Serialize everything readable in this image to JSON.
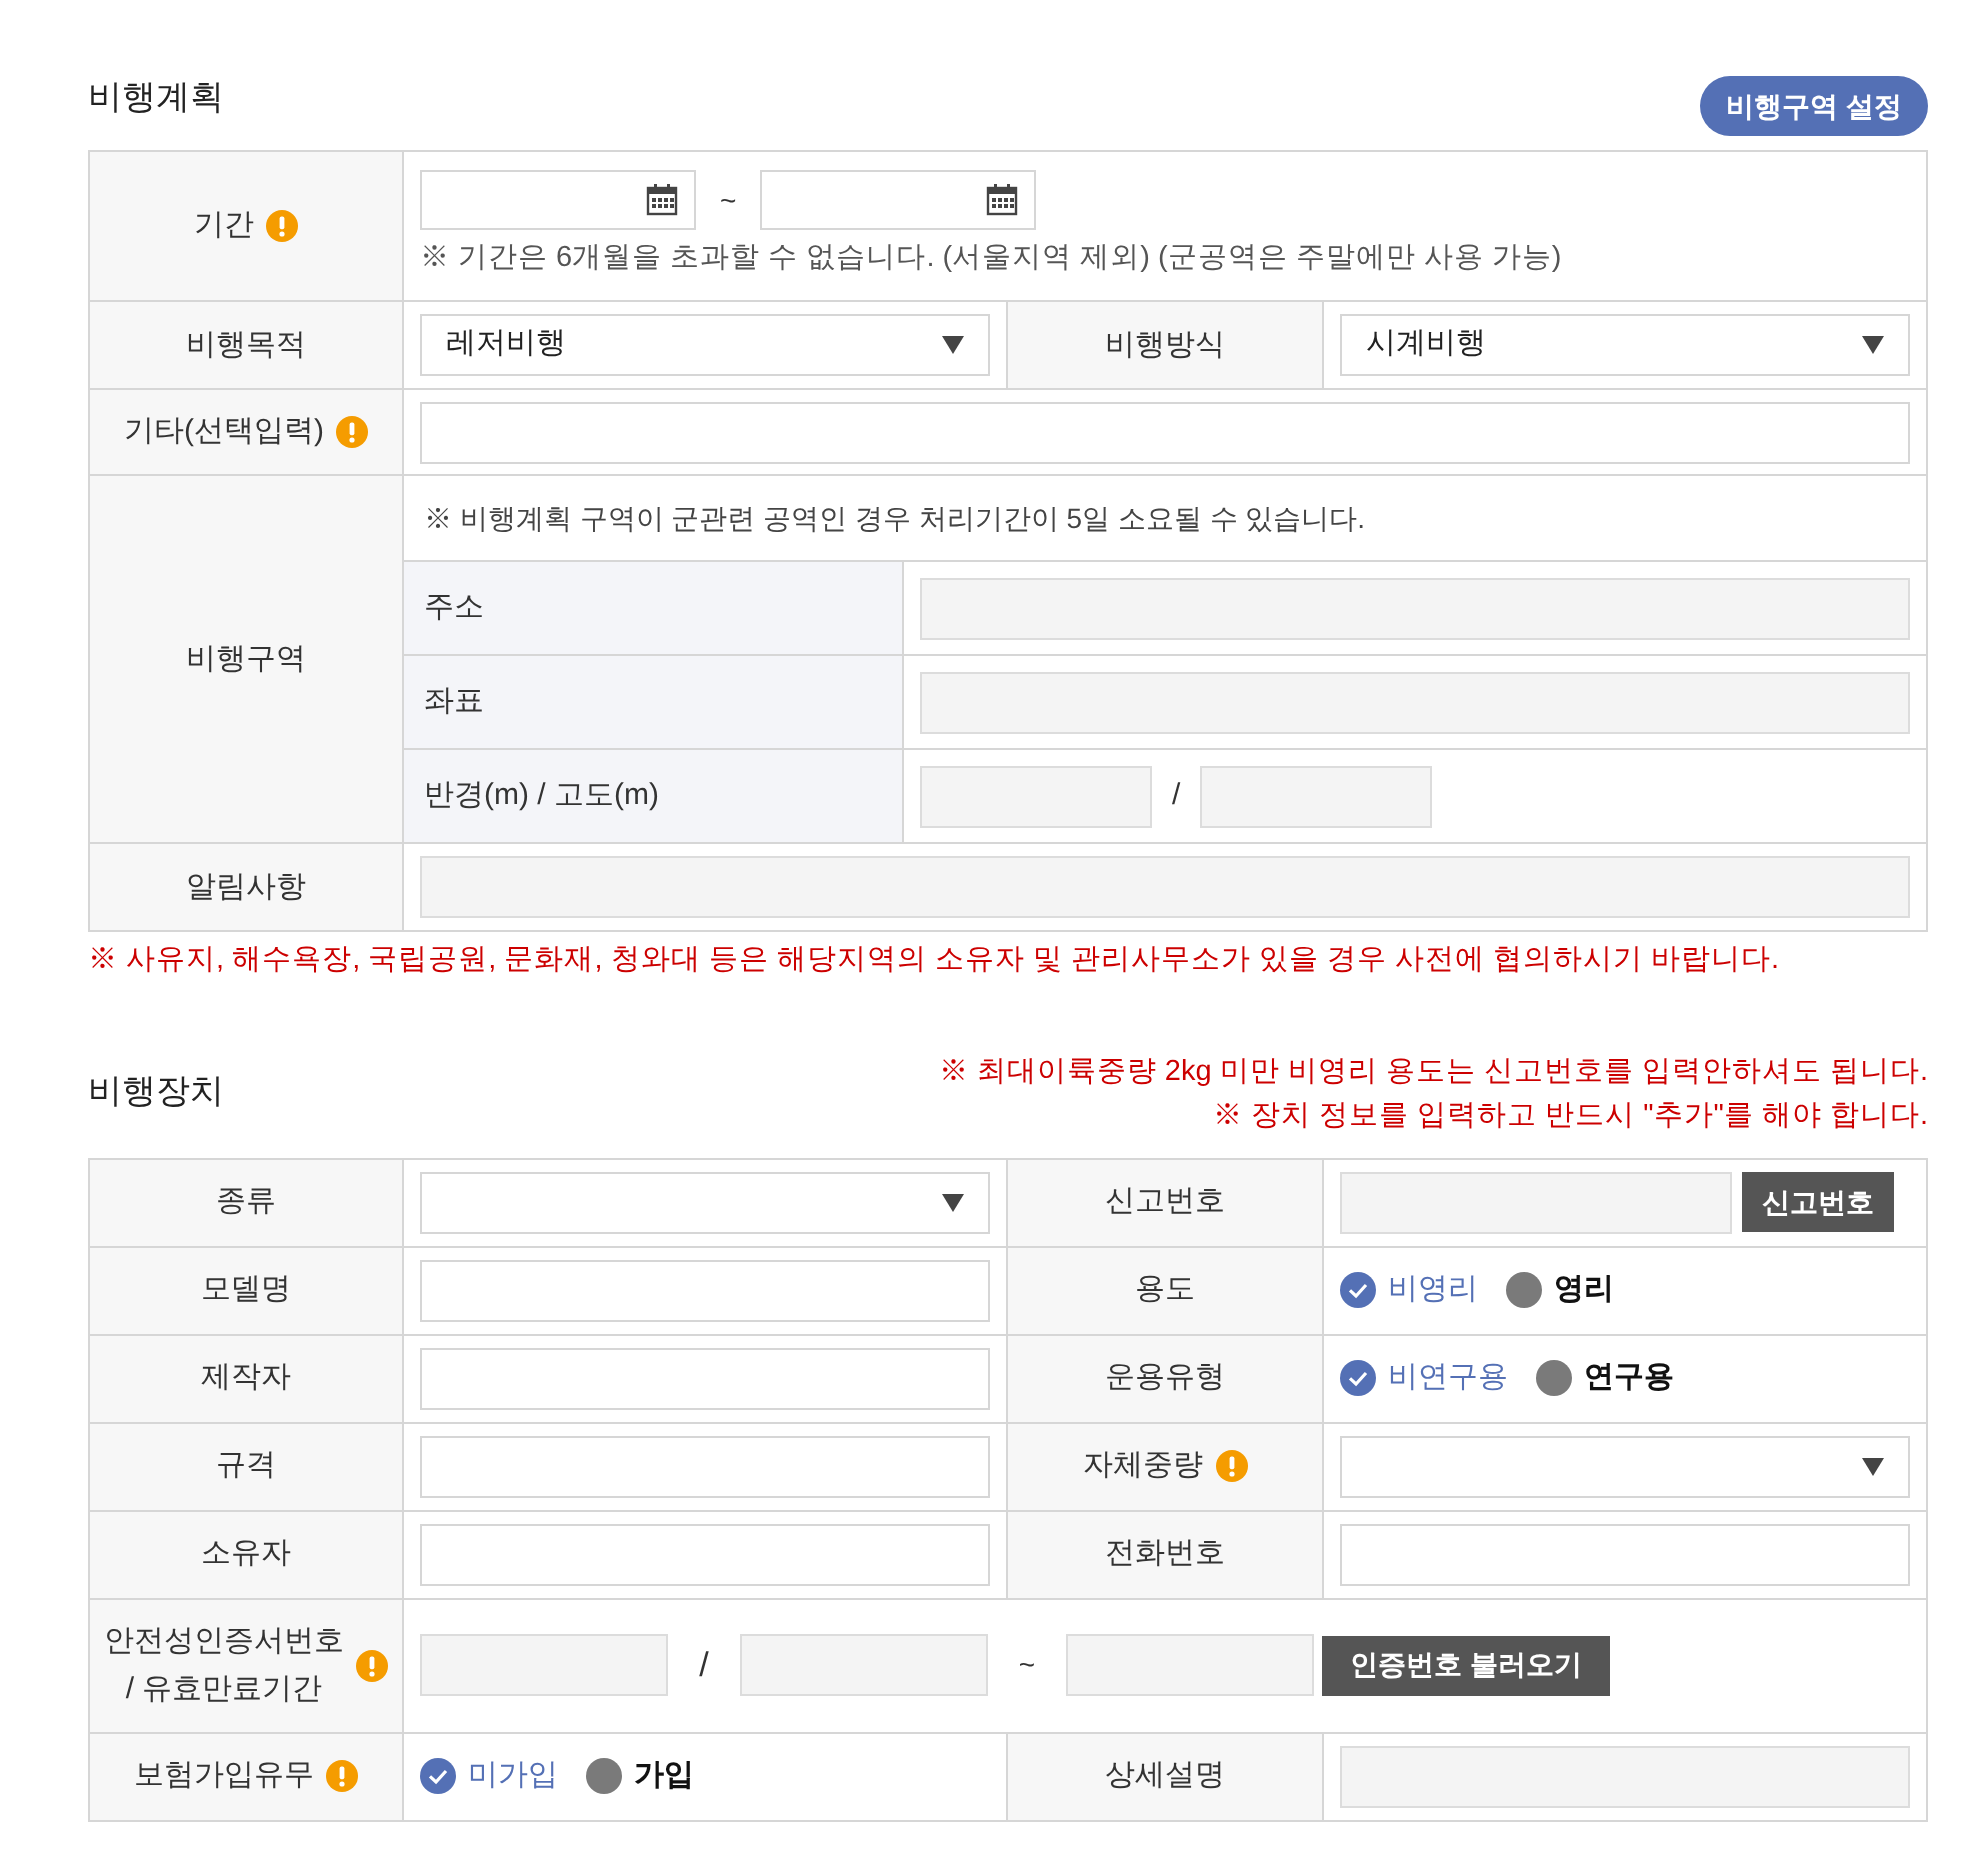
{
  "flight_plan": {
    "title": "비행계획",
    "zone_button": "비행구역 설정",
    "period": {
      "label": "기간",
      "info": true,
      "separator": "~",
      "note": "※ 기간은 6개월을 초과할 수 없습니다. (서울지역 제외) (군공역은 주말에만 사용 가능)"
    },
    "purpose": {
      "label": "비행목적",
      "value": "레저비행"
    },
    "method": {
      "label": "비행방식",
      "value": "시계비행"
    },
    "other": {
      "label": "기타(선택입력)",
      "info": true
    },
    "zone": {
      "label": "비행구역",
      "note": "※ 비행계획 구역이 군관련 공역인 경우 처리기간이 5일 소요될 수 있습니다.",
      "address_label": "주소",
      "coord_label": "좌표",
      "radius_label": "반경(m) / 고도(m)",
      "separator": "/"
    },
    "notice": {
      "label": "알림사항"
    },
    "warning": "※ 사유지, 해수욕장, 국립공원, 문화재, 청와대 등은 해당지역의 소유자 및 관리사무소가 있을 경우 사전에 협의하시기 바랍니다."
  },
  "device": {
    "title": "비행장치",
    "notes": [
      "※ 최대이륙중량 2kg 미만 비영리 용도는 신고번호를 입력안하셔도 됩니다.",
      "※ 장치 정보를 입력하고 반드시 \"추가\"를 해야 합니다."
    ],
    "rows": [
      [
        {
          "label": "종류",
          "control": {
            "kind": "select"
          }
        },
        {
          "label": "신고번호",
          "control": {
            "kind": "text_button",
            "button": "신고번호"
          }
        }
      ],
      [
        {
          "label": "모델명",
          "control": {
            "kind": "text"
          }
        },
        {
          "label": "용도",
          "control": {
            "kind": "radio",
            "options": [
              {
                "label": "비영리",
                "selected": true
              },
              {
                "label": "영리",
                "selected": false
              }
            ]
          }
        }
      ],
      [
        {
          "label": "제작자",
          "control": {
            "kind": "text"
          }
        },
        {
          "label": "운용유형",
          "control": {
            "kind": "radio",
            "options": [
              {
                "label": "비연구용",
                "selected": true
              },
              {
                "label": "연구용",
                "selected": false
              }
            ]
          }
        }
      ],
      [
        {
          "label": "규격",
          "control": {
            "kind": "text"
          }
        },
        {
          "label": "자체중량",
          "info": true,
          "control": {
            "kind": "select"
          }
        }
      ],
      [
        {
          "label": "소유자",
          "control": {
            "kind": "text"
          }
        },
        {
          "label": "전화번호",
          "control": {
            "kind": "text"
          }
        }
      ],
      [
        {
          "label": "안전성인증서번호\n/ 유효만료기간",
          "info": true,
          "control": {
            "kind": "cert",
            "separators": [
              "/",
              "~"
            ],
            "button": "인증번호 불러오기"
          }
        }
      ],
      [
        {
          "label": "보험가입유무",
          "info": true,
          "control": {
            "kind": "radio",
            "options": [
              {
                "label": "미가입",
                "selected": true
              },
              {
                "label": "가입",
                "selected": false
              }
            ]
          }
        },
        {
          "label": "상세설명",
          "control": {
            "kind": "readonly"
          }
        }
      ]
    ]
  }
}
